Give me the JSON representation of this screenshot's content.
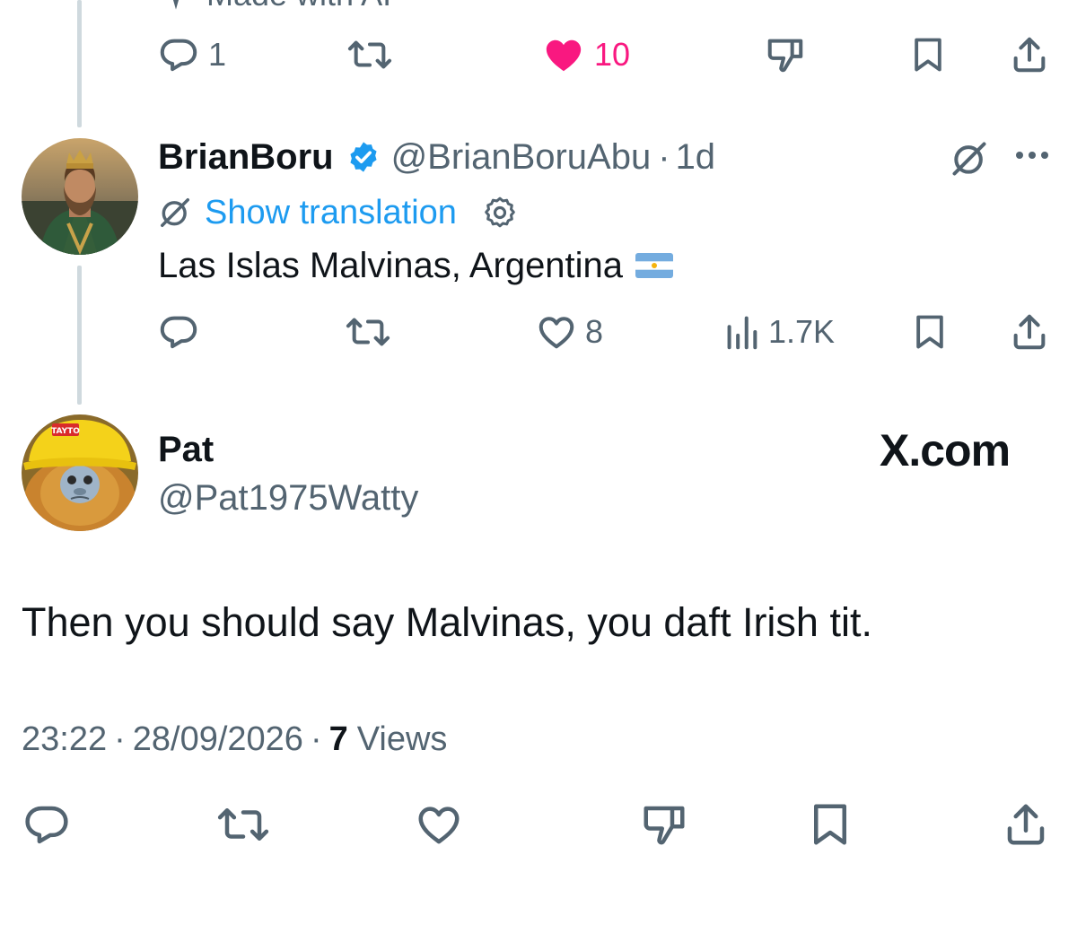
{
  "previous_tweet": {
    "made_with_ai_label": "Made with AI",
    "actions": {
      "reply_count": "1",
      "like_count": "10"
    }
  },
  "reply_tweet": {
    "display_name": "BrianBoru",
    "handle": "@BrianBoruAbu",
    "separator": "·",
    "time_ago": "1d",
    "show_translation_label": "Show translation",
    "text": "Las Islas Malvinas, Argentina",
    "flag_icon": "argentina-flag-icon",
    "actions": {
      "like_count": "8",
      "views_count": "1.7K"
    }
  },
  "main_tweet": {
    "display_name": "Pat",
    "handle": "@Pat1975Watty",
    "avatar_hat_text": "TAYTO",
    "watermark": "X.com",
    "text": "Then you should say Malvinas, you daft Irish tit.",
    "timestamp_time": "23:22",
    "timestamp_sep1": "·",
    "timestamp_date": "28/09/2026",
    "timestamp_sep2": "·",
    "views_count": "7",
    "views_label": "Views"
  },
  "colors": {
    "like_active": "#f91880",
    "link_blue": "#1d9bf0",
    "muted": "#536471",
    "text": "#0f1419",
    "verified": "#1d9bf0"
  }
}
